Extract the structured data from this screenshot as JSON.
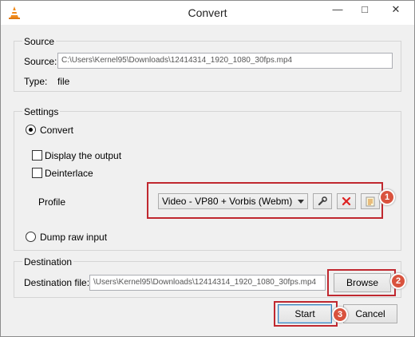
{
  "window": {
    "title": "Convert",
    "minimize_glyph": "—",
    "maximize_glyph": "□",
    "close_glyph": "✕"
  },
  "source": {
    "group_title": "Source",
    "source_label": "Source:",
    "source_value": "C:\\Users\\Kernel95\\Downloads\\12414314_1920_1080_30fps.mp4",
    "type_label": "Type:",
    "type_value": "file"
  },
  "settings": {
    "group_title": "Settings",
    "convert_label": "Convert",
    "display_output_label": "Display the output",
    "deinterlace_label": "Deinterlace",
    "profile_label": "Profile",
    "profile_value": "Video - VP80 + Vorbis (Webm)",
    "dump_raw_label": "Dump raw input"
  },
  "destination": {
    "group_title": "Destination",
    "file_label": "Destination file:",
    "file_value": "\\Users\\Kernel95\\Downloads\\12414314_1920_1080_30fps.mp4",
    "browse_label": "Browse"
  },
  "footer": {
    "start_label": "Start",
    "cancel_label": "Cancel"
  },
  "annotations": [
    "1",
    "2",
    "3"
  ],
  "icons": {
    "edit": "wrench-icon",
    "delete": "delete-icon",
    "new": "new-profile-icon",
    "app": "vlc-cone-icon"
  },
  "colors": {
    "highlight": "#c0282f",
    "badge": "#d9533e",
    "delete": "#d22"
  }
}
